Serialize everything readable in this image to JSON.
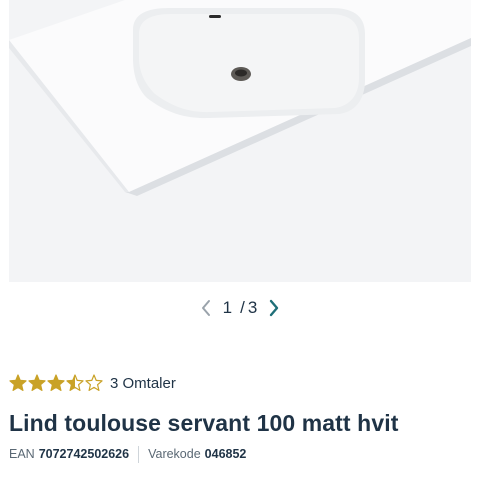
{
  "product": {
    "image_icon": "washbasin-image",
    "gallery": {
      "current": "1",
      "separator": "/",
      "total": "3"
    },
    "rating": {
      "value": 3.5,
      "max": 5,
      "reviews_label": "3 Omtaler",
      "star_color": "#c9a227"
    },
    "title": "Lind toulouse servant 100 matt hvit",
    "ean": {
      "label": "EAN",
      "value": "7072742502626"
    },
    "sku": {
      "label": "Varekode",
      "value": "046852"
    }
  },
  "colors": {
    "text": "#1f3346",
    "accent": "#1f6f78",
    "muted": "#5a6874"
  }
}
